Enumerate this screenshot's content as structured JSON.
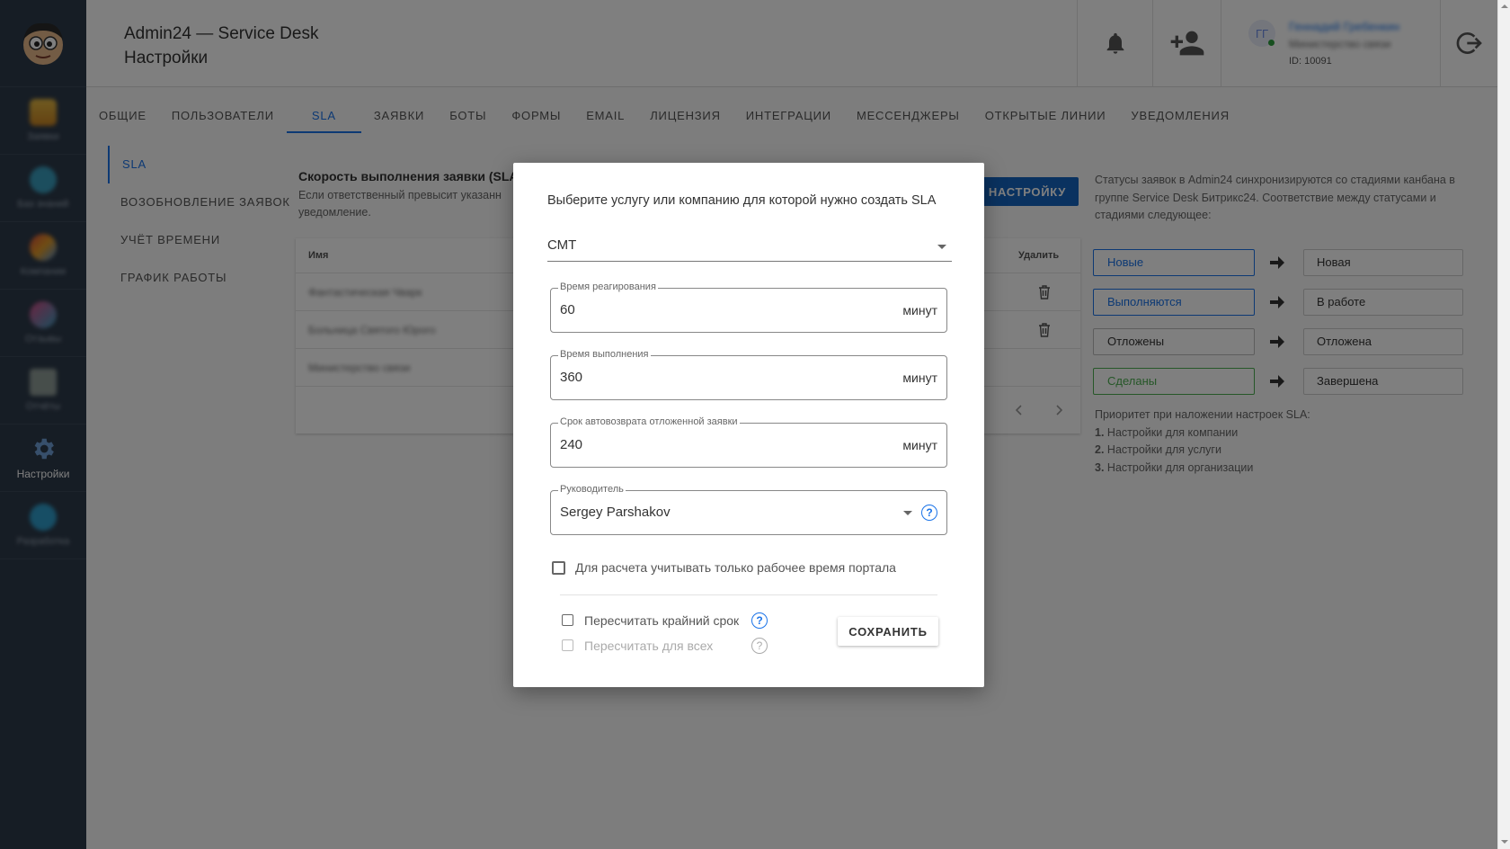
{
  "colors": {
    "sidebar": "#2d3a4a",
    "accent": "#1a73e8",
    "primary_button": "#1565c0",
    "done_border": "#4caf50"
  },
  "sidebar": {
    "items": [
      {
        "label": "Заявки",
        "icon": "ticket-icon",
        "active": false
      },
      {
        "label": "Баз знаний",
        "icon": "knowledge-icon",
        "active": false
      },
      {
        "label": "Компании",
        "icon": "companies-icon",
        "active": false
      },
      {
        "label": "Отзывы",
        "icon": "reviews-icon",
        "active": false
      },
      {
        "label": "Отчёты",
        "icon": "reports-icon",
        "active": false
      },
      {
        "label": "Настройки",
        "icon": "gear-icon",
        "active": true
      },
      {
        "label": "Разработка",
        "icon": "developer-icon",
        "active": false
      }
    ]
  },
  "header": {
    "app_title": "Admin24 — Service Desk",
    "page_title": "Настройки",
    "user_initials": "ГГ",
    "user_name": "Геннадий Гребенкин",
    "user_org": "Министерство связи",
    "user_id": "ID: 10091"
  },
  "tabs": [
    {
      "label": "ОБЩИЕ",
      "active": false
    },
    {
      "label": "ПОЛЬЗОВАТЕЛИ",
      "active": false
    },
    {
      "label": "SLA",
      "active": true
    },
    {
      "label": "ЗАЯВКИ",
      "active": false
    },
    {
      "label": "БОТЫ",
      "active": false
    },
    {
      "label": "ФОРМЫ",
      "active": false
    },
    {
      "label": "EMAIL",
      "active": false
    },
    {
      "label": "ЛИЦЕНЗИЯ",
      "active": false
    },
    {
      "label": "ИНТЕГРАЦИИ",
      "active": false
    },
    {
      "label": "МЕССЕНДЖЕРЫ",
      "active": false
    },
    {
      "label": "ОТКРЫТЫЕ ЛИНИИ",
      "active": false
    },
    {
      "label": "УВЕДОМЛЕНИЯ",
      "active": false
    }
  ],
  "submenu": [
    {
      "label": "SLA",
      "active": true
    },
    {
      "label": "ВОЗОБНОВЛЕНИЕ ЗАЯВОК",
      "active": false
    },
    {
      "label": "УЧЁТ ВРЕМЕНИ",
      "active": false
    },
    {
      "label": "ГРАФИК РАБОТЫ",
      "active": false
    }
  ],
  "content": {
    "title": "Скорость выполнения заявки (SLA",
    "description": "Если ответственный превысит указанн уведомление.",
    "add_button": "Ь НАСТРОЙКУ",
    "table": {
      "col_name": "Имя",
      "col_delete": "Удалить",
      "rows": [
        "Фантастическая Чварк",
        "Больница Святого Юрого",
        "Министерство связи"
      ]
    }
  },
  "right_panel": {
    "info": "Статусы заявок в Admin24 синхронизируются со стадиями канбана в группе Service Desk Битрикс24. Соответствие между статусами и стадиями следующее:",
    "mappings": [
      {
        "status": "Новые",
        "stage": "Новая"
      },
      {
        "status": "Выполняются",
        "stage": "В работе"
      },
      {
        "status": "Отложены",
        "stage": "Отложена"
      },
      {
        "status": "Сделаны",
        "stage": "Завершена"
      }
    ],
    "priority_title": "Приоритет при наложении настроек SLA:",
    "priority_items": [
      {
        "num": "1.",
        "text": "Настройки для компании"
      },
      {
        "num": "2.",
        "text": "Настройки для услуги"
      },
      {
        "num": "3.",
        "text": "Настройки для организации"
      }
    ]
  },
  "modal": {
    "title": "Выберите услугу или компанию для которой нужно создать SLA",
    "select_value": "СМТ",
    "fields": [
      {
        "label": "Время реагирования",
        "value": "60",
        "unit": "минут"
      },
      {
        "label": "Время выполнения",
        "value": "360",
        "unit": "минут"
      },
      {
        "label": "Срок автовозврата отложенной заявки",
        "value": "240",
        "unit": "минут"
      }
    ],
    "manager": {
      "label": "Руководитель",
      "value": "Sergey Parshakov"
    },
    "work_time_checkbox": "Для расчета учитывать только рабочее время портала",
    "recalc_deadline": "Пересчитать крайний срок",
    "recalc_all": "Пересчитать для всех",
    "save_button": "СОХРАНИТЬ"
  }
}
